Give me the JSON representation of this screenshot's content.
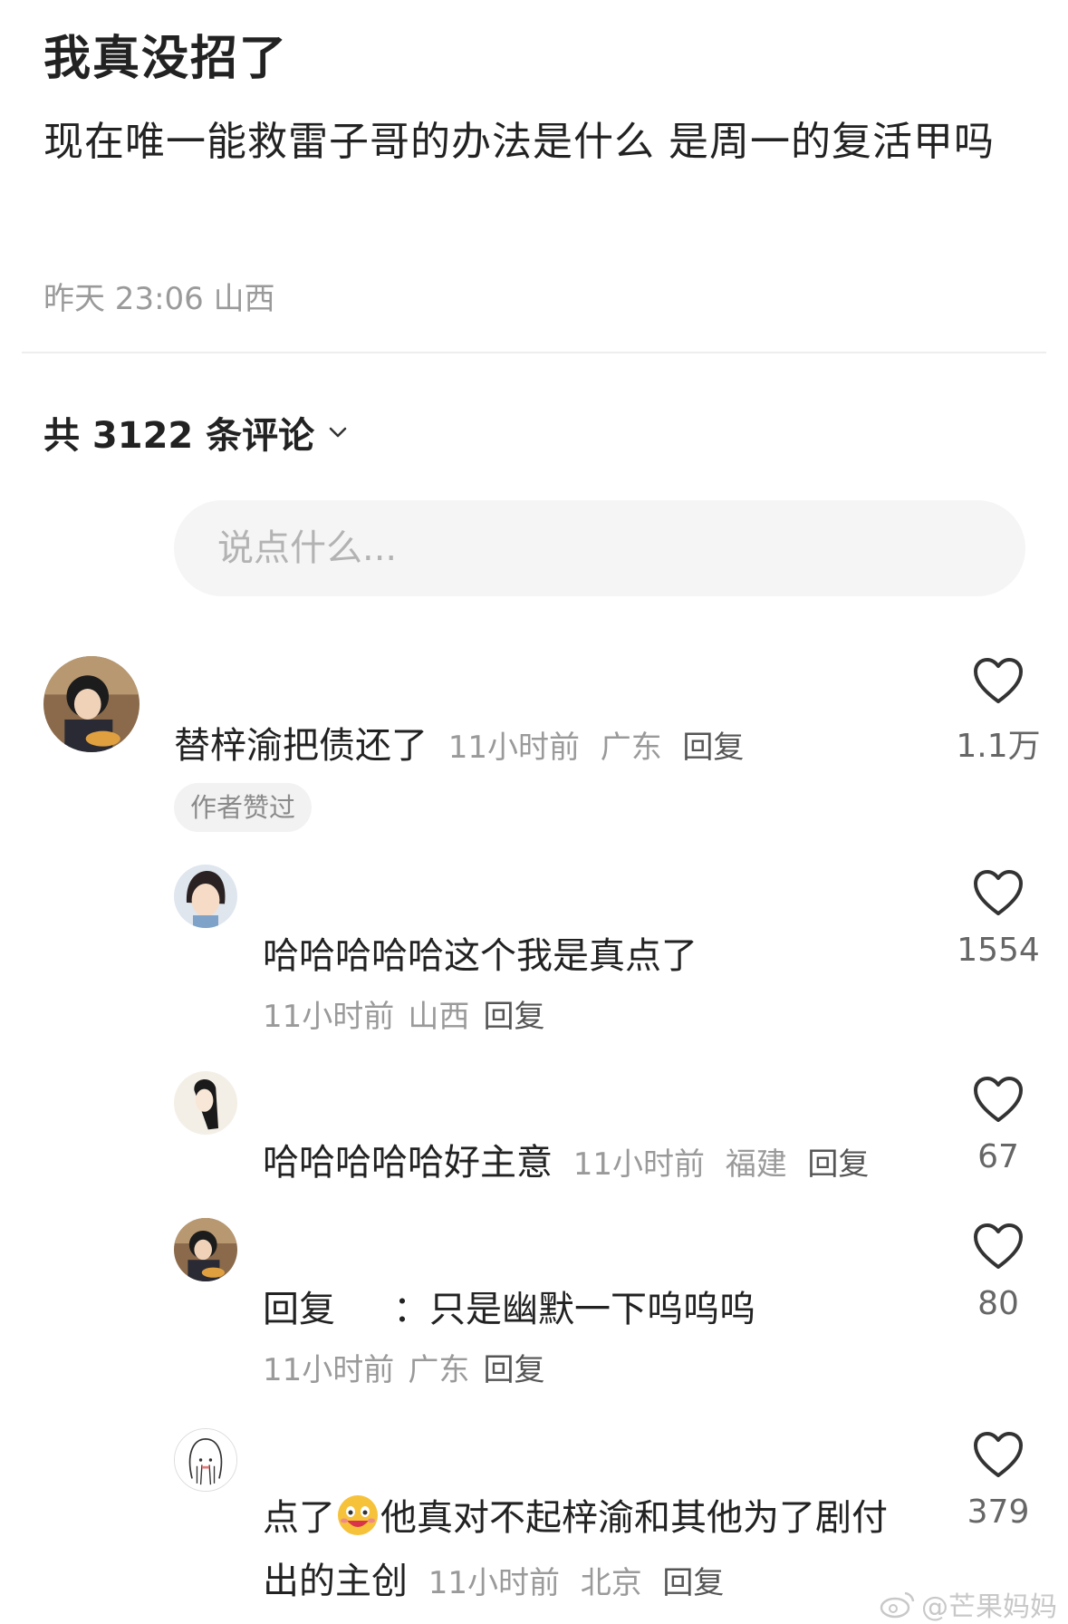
{
  "post": {
    "title": "我真没招了",
    "body": "现在唯一能救雷子哥的办法是什么  是周一的复活甲吗",
    "meta": "昨天 23:06 山西"
  },
  "comments_header": {
    "count_label": "共 3122 条评论"
  },
  "input": {
    "placeholder": "说点什么..."
  },
  "comments": [
    {
      "text": "替梓渝把债还了",
      "time": "11小时前",
      "location": "广东",
      "reply_label": "回复",
      "likes": "1.1万",
      "badge": "作者赞过",
      "replies": [
        {
          "text": "哈哈哈哈哈这个我是真点了",
          "time": "11小时前",
          "location": "山西",
          "reply_label": "回复",
          "likes": "1554"
        },
        {
          "text": "哈哈哈哈哈好主意",
          "time": "11小时前",
          "location": "福建",
          "reply_label": "回复",
          "likes": "67"
        },
        {
          "text_prefix": "回复",
          "text": "：只是幽默一下呜呜呜",
          "time": "11小时前",
          "location": "广东",
          "reply_label": "回复",
          "likes": "80"
        },
        {
          "text_before_emoji": "点了",
          "text_after_emoji": "他真对不起梓渝和其他为了剧付",
          "text_line2": "出的主创",
          "time": "11小时前",
          "location": "北京",
          "reply_label": "回复",
          "likes": "379"
        }
      ]
    }
  ],
  "watermark": {
    "text": "@芒果妈妈"
  },
  "icons": {
    "like": "heart-outline-icon",
    "expand": "chevron-down-icon",
    "emoji": "laughing-emoji-icon",
    "weibo": "weibo-logo-icon"
  }
}
